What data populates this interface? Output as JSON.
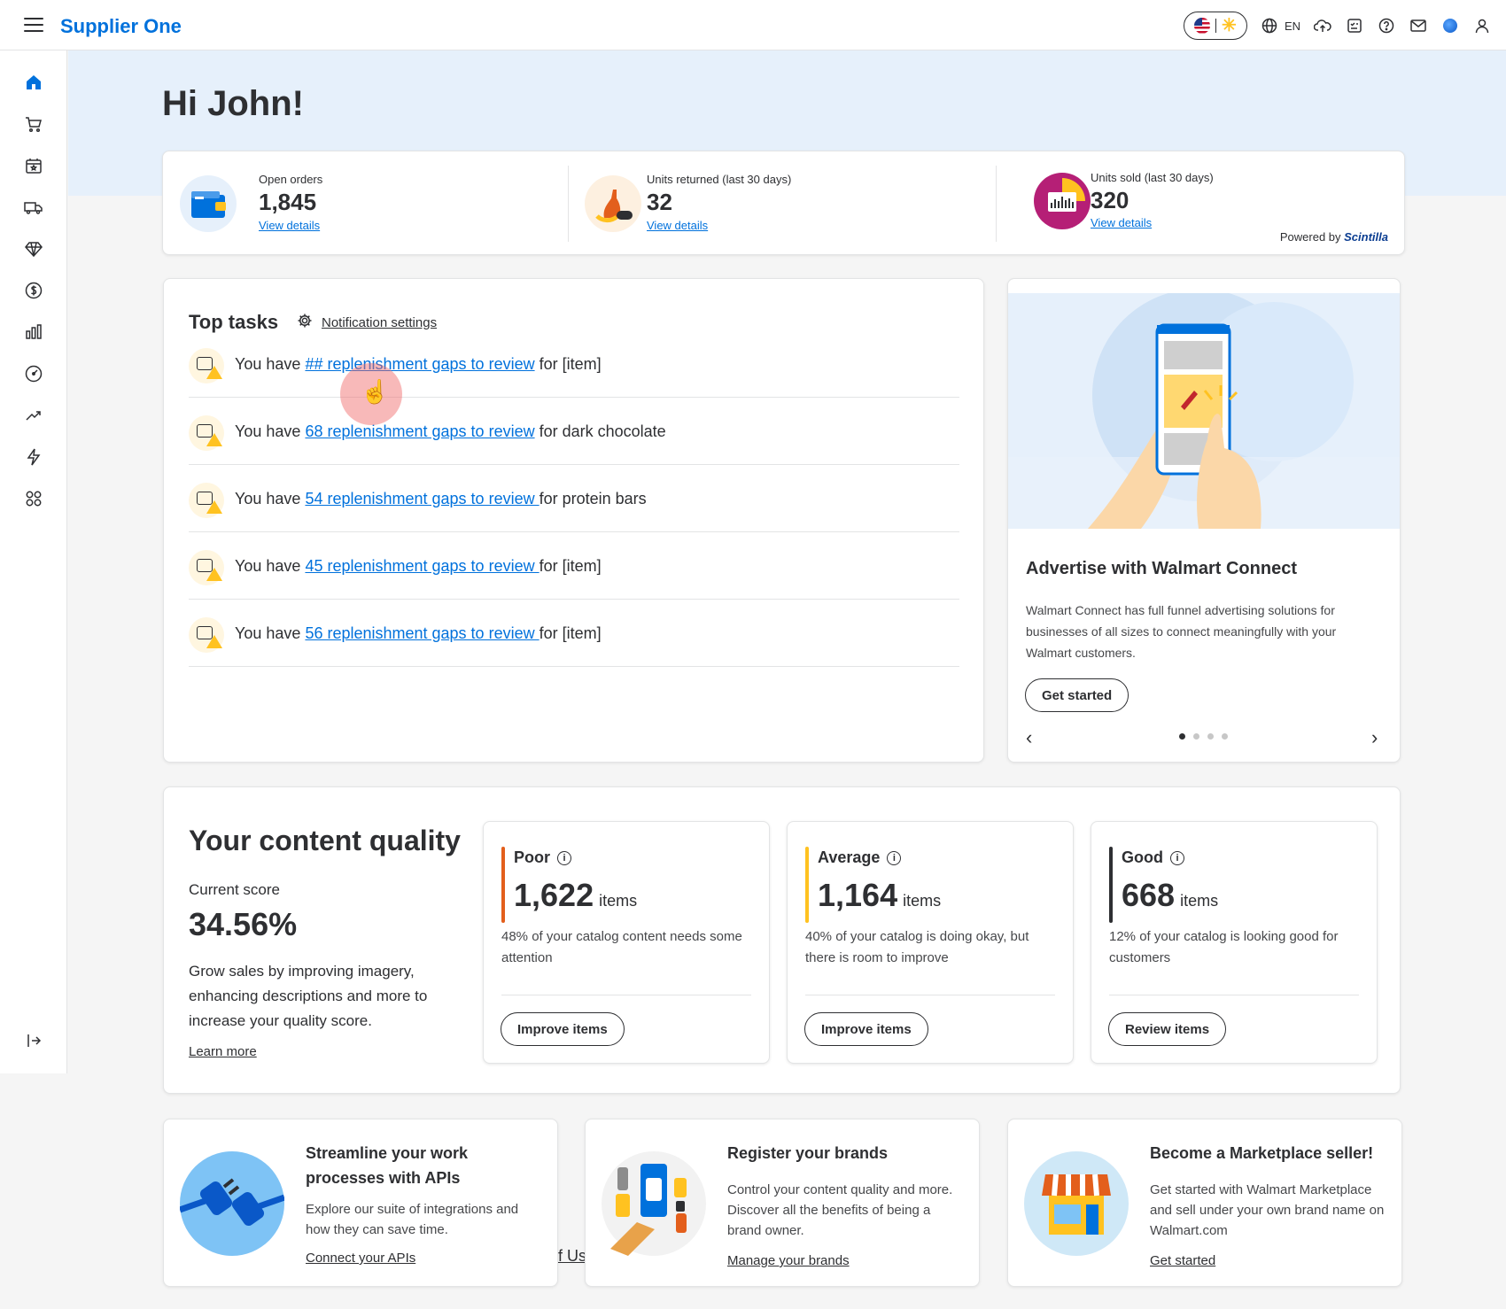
{
  "app": {
    "brand": "Supplier One"
  },
  "topbar": {
    "language": "EN",
    "icons": [
      "flag-icon",
      "spark-icon",
      "globe-icon",
      "cloud-upload-icon",
      "checklist-icon",
      "help-icon",
      "mail-icon",
      "avatar-icon",
      "user-icon"
    ]
  },
  "sidebar": {
    "icons": [
      "home-icon",
      "cart-icon",
      "store-icon",
      "truck-icon",
      "diamond-icon",
      "dollar-icon",
      "bar-chart-icon",
      "gauge-icon",
      "trend-icon",
      "bolt-icon",
      "apps-icon",
      "collapse-icon"
    ]
  },
  "greeting": "Hi John!",
  "stats": {
    "items": [
      {
        "label": "Open orders",
        "value": "1,845",
        "link": "View details"
      },
      {
        "label": "Units returned (last 30 days)",
        "value": "32",
        "link": "View details"
      },
      {
        "label": "Units sold (last 30 days)",
        "value": "320",
        "link": "View details"
      }
    ],
    "powered_prefix": "Powered by",
    "powered_brand": "Scintilla"
  },
  "tasks": {
    "title": "Top tasks",
    "notification_settings": "Notification settings",
    "items": [
      {
        "prefix": "You have",
        "link": "## replenishment gaps to review",
        "suffix": "for [item]"
      },
      {
        "prefix": "You have",
        "link": "68 replenishment gaps to review",
        "suffix": "for dark chocolate"
      },
      {
        "prefix": "You have",
        "link": "54 replenishment gaps to review ",
        "suffix": "for protein bars"
      },
      {
        "prefix": "You have",
        "link": "45 replenishment gaps to review ",
        "suffix": "for [item]"
      },
      {
        "prefix": "You have",
        "link": "56 replenishment gaps to review ",
        "suffix": "for [item]"
      }
    ]
  },
  "promo": {
    "title": "Advertise with Walmart Connect",
    "body": "Walmart Connect has full funnel advertising solutions for businesses of all sizes to connect meaningfully with your Walmart customers.",
    "button": "Get started",
    "prev": "‹",
    "next": "›",
    "slides": 4,
    "active_slide": 1
  },
  "quality": {
    "title": "Your content quality",
    "current_label": "Current score",
    "score": "34.56%",
    "description": "Grow sales by improving imagery, enhancing descriptions and more to increase your quality score.",
    "learn_more": "Learn more",
    "cards": [
      {
        "name": "Poor",
        "count": "1,622",
        "unit": "items",
        "note": "48% of your catalog content needs some attention",
        "button": "Improve items",
        "color": "#e35f1c"
      },
      {
        "name": "Average",
        "count": "1,164",
        "unit": "items",
        "note": "40% of your catalog is doing okay, but there is room to improve",
        "button": "Improve items",
        "color": "#ffc220"
      },
      {
        "name": "Good",
        "count": "668",
        "unit": "items",
        "note": "12% of your catalog is looking good for customers",
        "button": "Review items",
        "color": "#2e2f32"
      }
    ]
  },
  "bottom": [
    {
      "title": "Streamline your work processes with APIs",
      "body": "Explore our suite of integrations and how they can save time.",
      "link": "Connect your APIs"
    },
    {
      "title": "Register your brands",
      "body": "Control your content quality and more. Discover all the benefits of being a brand owner.",
      "link": "Manage your brands"
    },
    {
      "title": "Become a Marketplace seller!",
      "body": "Get started with Walmart Marketplace and sell under your own brand name on Walmart.com",
      "link": "Get started"
    }
  ],
  "ghost_text": "f Us",
  "colors": {
    "accent": "#0071dc",
    "yellow": "#ffc220",
    "hero": "#e6f0fb"
  }
}
